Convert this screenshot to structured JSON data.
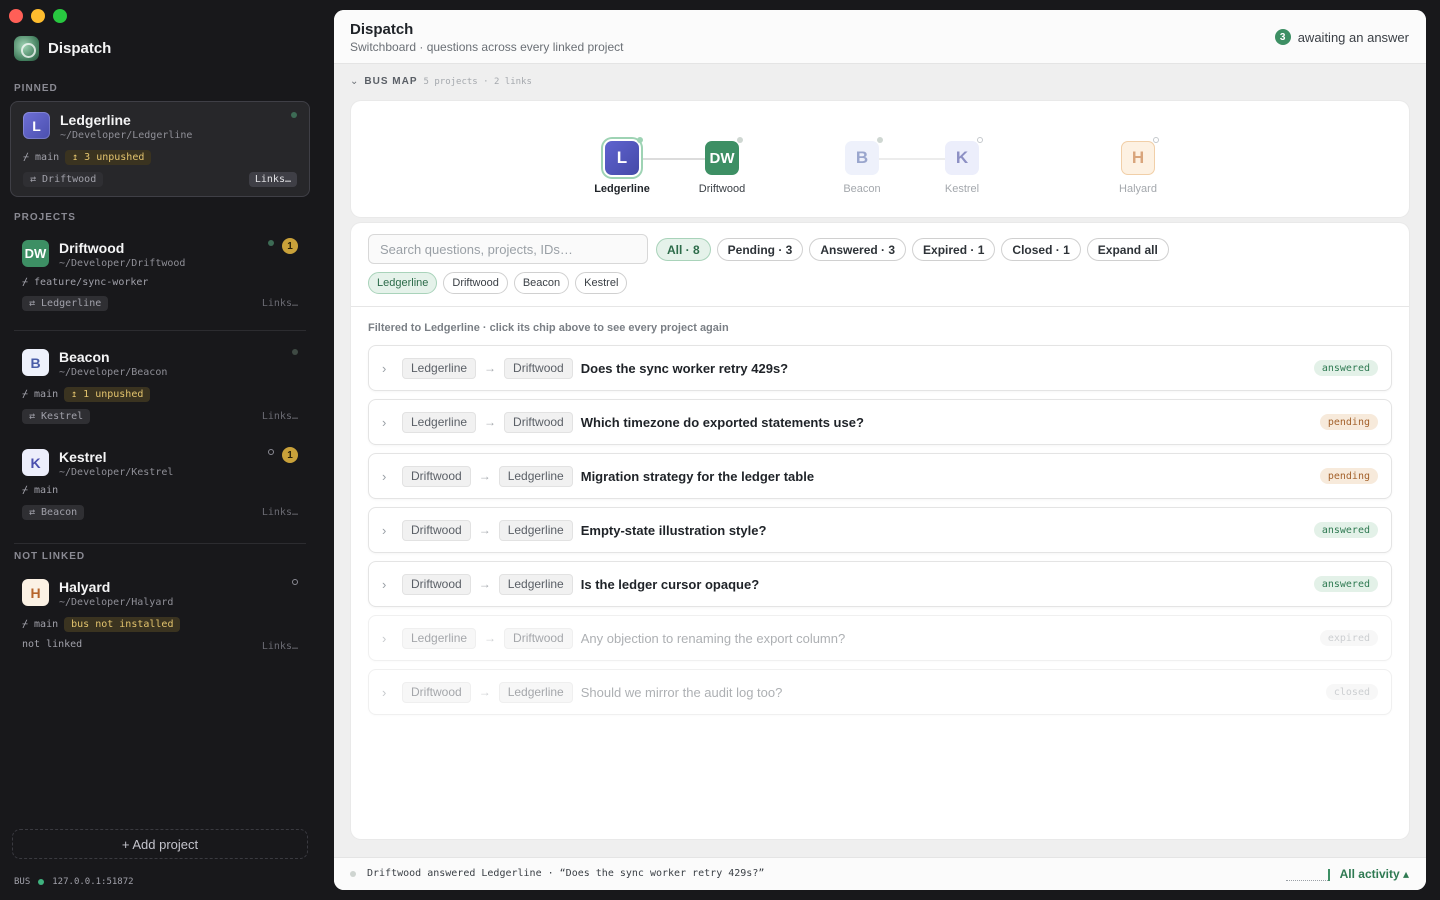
{
  "app": {
    "name": "Dispatch"
  },
  "sidebar": {
    "sections": {
      "pinned": "PINNED",
      "projects": "PROJECTS",
      "not_linked": "NOT LINKED"
    },
    "pinned": {
      "initial": "L",
      "name": "Ledgerline",
      "path": "~/Developer/Ledgerline",
      "branch": "main",
      "unpushed": "↥ 3 unpushed",
      "link": "⇄ Driftwood",
      "links_btn": "Links…"
    },
    "projects": [
      {
        "initial": "DW",
        "name": "Driftwood",
        "path": "~/Developer/Driftwood",
        "branch": "feature/sync-worker",
        "link": "⇄ Ledgerline",
        "links_btn": "Links…",
        "count": "1"
      },
      {
        "initial": "B",
        "name": "Beacon",
        "path": "~/Developer/Beacon",
        "branch": "main",
        "unpushed": "↥ 1 unpushed",
        "link": "⇄ Kestrel",
        "links_btn": "Links…"
      },
      {
        "initial": "K",
        "name": "Kestrel",
        "path": "~/Developer/Kestrel",
        "branch": "main",
        "link": "⇄ Beacon",
        "links_btn": "Links…",
        "count": "1"
      }
    ],
    "not_linked": {
      "initial": "H",
      "name": "Halyard",
      "path": "~/Developer/Halyard",
      "branch": "main",
      "warning": "bus not installed",
      "link": "not linked",
      "links_btn": "Links…"
    },
    "add_project": "+ Add project",
    "bus": {
      "label": "BUS",
      "address": "127.0.0.1:51872"
    }
  },
  "header": {
    "title": "Dispatch",
    "subtitle": "Switchboard · questions across every linked project",
    "await_count": "3",
    "await_label": "awaiting an answer"
  },
  "busmap": {
    "label": "BUS MAP",
    "meta": "5 projects · 2 links",
    "nodes": [
      {
        "initial": "L",
        "name": "Ledgerline"
      },
      {
        "initial": "DW",
        "name": "Driftwood"
      },
      {
        "initial": "B",
        "name": "Beacon"
      },
      {
        "initial": "K",
        "name": "Kestrel"
      },
      {
        "initial": "H",
        "name": "Halyard"
      }
    ]
  },
  "questions_panel": {
    "search_placeholder": "Search questions, projects, IDs…",
    "filters": [
      "All · 8",
      "Pending · 3",
      "Answered · 3",
      "Expired · 1",
      "Closed · 1"
    ],
    "expand_all": "Expand all",
    "project_chips": [
      "Ledgerline",
      "Driftwood",
      "Beacon",
      "Kestrel"
    ],
    "filtered_note": "Filtered to Ledgerline · click its chip above to see every project again",
    "questions": [
      {
        "from": "Ledgerline",
        "to": "Driftwood",
        "text": "Does the sync worker retry 429s?",
        "status": "answered"
      },
      {
        "from": "Ledgerline",
        "to": "Driftwood",
        "text": "Which timezone do exported statements use?",
        "status": "pending"
      },
      {
        "from": "Driftwood",
        "to": "Ledgerline",
        "text": "Migration strategy for the ledger table",
        "status": "pending"
      },
      {
        "from": "Driftwood",
        "to": "Ledgerline",
        "text": "Empty-state illustration style?",
        "status": "answered"
      },
      {
        "from": "Driftwood",
        "to": "Ledgerline",
        "text": "Is the ledger cursor opaque?",
        "status": "answered"
      },
      {
        "from": "Ledgerline",
        "to": "Driftwood",
        "text": "Any objection to renaming the export column?",
        "status": "expired"
      },
      {
        "from": "Driftwood",
        "to": "Ledgerline",
        "text": "Should we mirror the audit log too?",
        "status": "closed"
      }
    ]
  },
  "footer": {
    "activity": "Driftwood answered Ledgerline · “Does the sync worker retry 429s?”",
    "all_activity": "All activity ▴"
  }
}
